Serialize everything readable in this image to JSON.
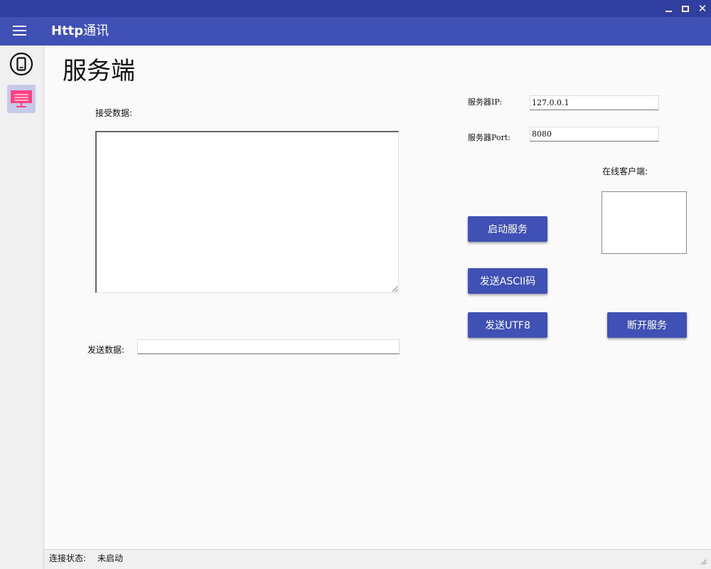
{
  "app": {
    "title_latin": "Http",
    "title_cjk": "通讯"
  },
  "window_controls": {
    "close_glyph": "✕"
  },
  "sidebar": {
    "items": [
      {
        "name": "phone",
        "icon": "smartphone-icon",
        "selected": false
      },
      {
        "name": "server",
        "icon": "monitor-icon",
        "selected": true,
        "icon_color": "#ff4081"
      }
    ]
  },
  "page": {
    "title": "服务端"
  },
  "receive": {
    "label": "接受数据:",
    "value": ""
  },
  "send": {
    "label": "发送数据:",
    "value": ""
  },
  "server": {
    "ip_label": "服务器IP:",
    "ip_value": "127.0.0.1",
    "port_label": "服务器Port:",
    "port_value": "8080"
  },
  "clients": {
    "label": "在线客户端:",
    "items": []
  },
  "buttons": {
    "start": "启动服务",
    "send_ascii": "发送ASCII码",
    "send_utf8": "发送UTF8",
    "stop": "断开服务"
  },
  "status": {
    "label": "连接状态:",
    "value": "未启动"
  },
  "colors": {
    "titlebar": "#303f9f",
    "appbar": "#3f51b5",
    "button": "#3f51b5",
    "nav_selected": "#c5cae9",
    "accent": "#ff4081"
  }
}
